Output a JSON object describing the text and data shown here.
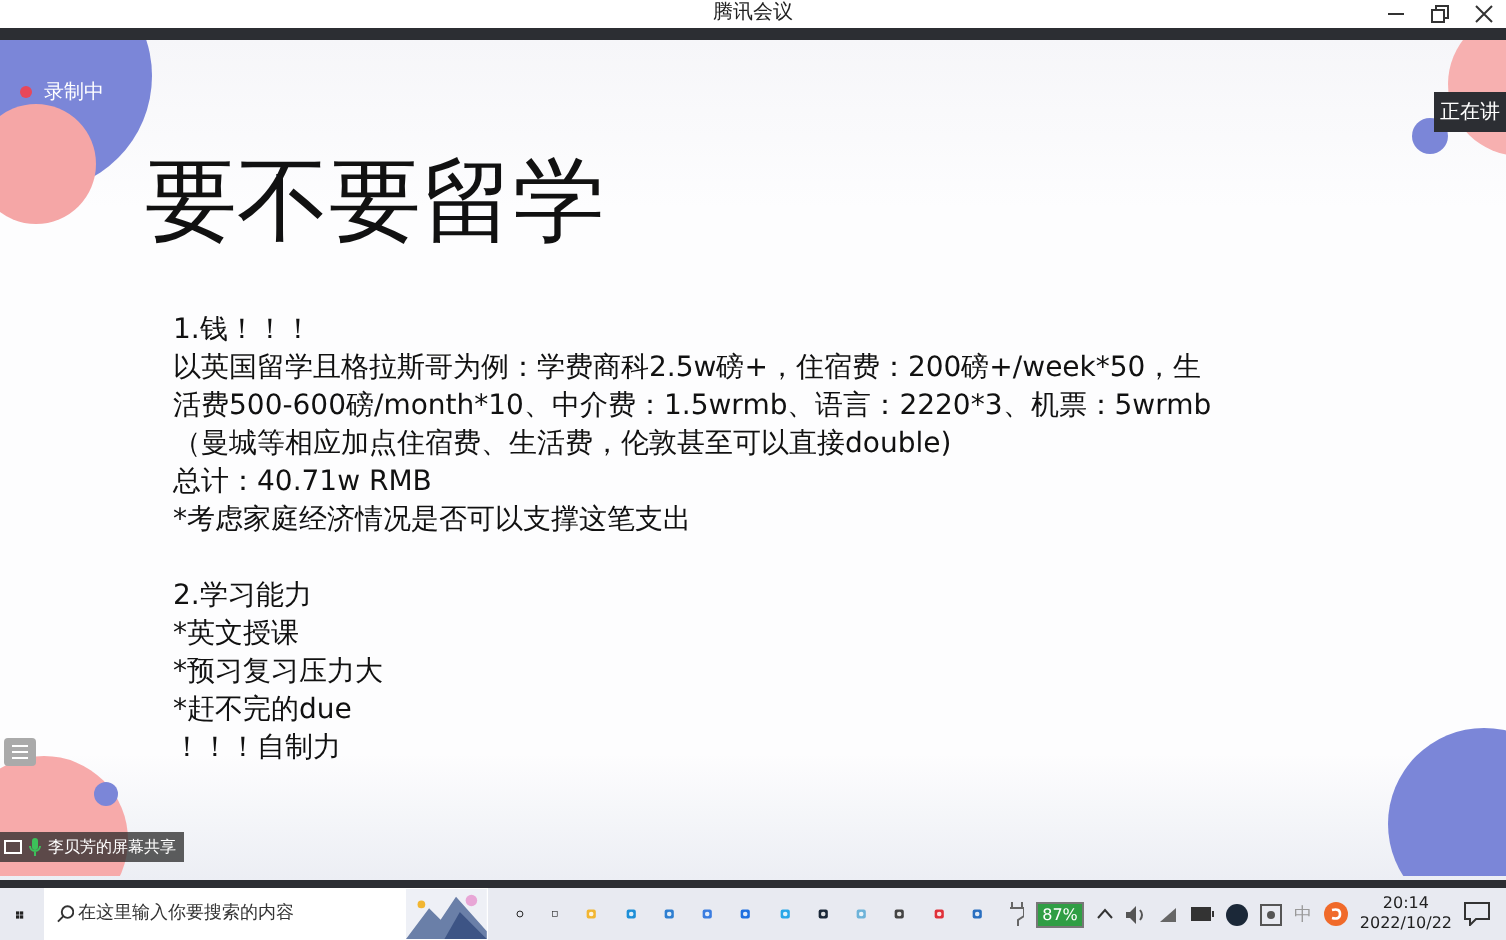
{
  "window": {
    "title": "腾讯会议"
  },
  "recording": {
    "label": "录制中"
  },
  "speaker_tag": {
    "label": "正在讲"
  },
  "slide": {
    "title": "要不要留学",
    "sections": [
      {
        "heading": "1.钱！！！",
        "lines": [
          "以英国留学且格拉斯哥为例：学费商科2.5w磅+，住宿费：200磅+/week*50，生活费500-600磅/month*10、中介费：1.5wrmb、语言：2220*3、机票：5wrmb（曼城等相应加点住宿费、生活费，伦敦甚至可以直接double)",
          "总计：40.71w RMB",
          "*考虑家庭经济情况是否可以支撑这笔支出"
        ]
      },
      {
        "heading": "2.学习能力",
        "lines": [
          "*英文授课",
          "*预习复习压力大",
          "*赶不完的due",
          "！！！自制力"
        ]
      }
    ]
  },
  "share_label": "李贝芳的屏幕共享",
  "taskbar": {
    "search": {
      "placeholder": "在这里输入你要搜索的内容"
    },
    "battery": "87%",
    "ime": "中",
    "time": "20:14",
    "date": "2022/10/22"
  }
}
